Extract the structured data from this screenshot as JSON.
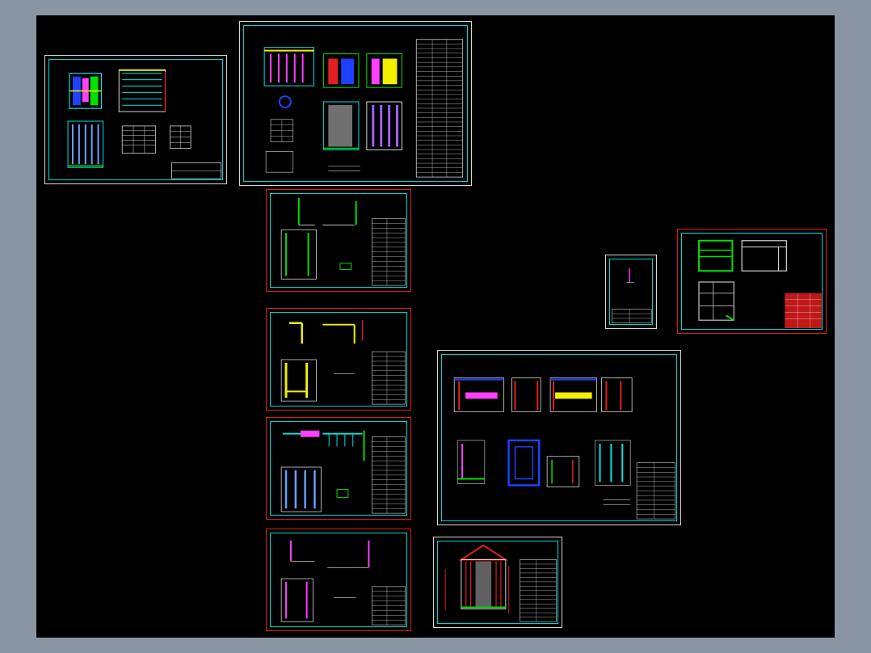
{
  "viewer": {
    "background": "#000000",
    "colors": {
      "cyan": "#00e5e5",
      "red": "#e02020",
      "white": "#d8d8d8",
      "yellow": "#f0f000",
      "green": "#00e000",
      "magenta": "#ff40ff",
      "blue": "#2040ff"
    }
  },
  "sheets": [
    {
      "id": "sheet-plan-overview",
      "frame": "white"
    },
    {
      "id": "sheet-main-assembly",
      "frame": "white"
    },
    {
      "id": "sheet-section-a",
      "frame": "red"
    },
    {
      "id": "sheet-section-b",
      "frame": "red"
    },
    {
      "id": "sheet-section-c",
      "frame": "red"
    },
    {
      "id": "sheet-section-d",
      "frame": "red"
    },
    {
      "id": "sheet-small-detail",
      "frame": "white"
    },
    {
      "id": "sheet-frame-detail",
      "frame": "red"
    },
    {
      "id": "sheet-multi-detail",
      "frame": "white"
    },
    {
      "id": "sheet-elevation",
      "frame": "white"
    }
  ]
}
